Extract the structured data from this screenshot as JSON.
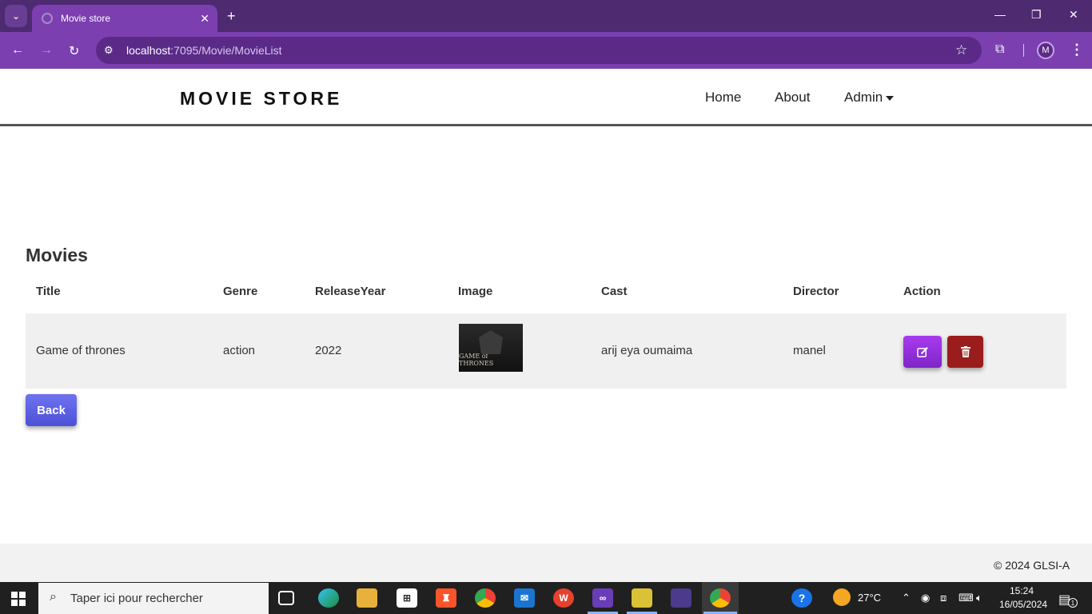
{
  "browser": {
    "tab_title": "Movie store",
    "tab_close": "✕",
    "new_tab": "+",
    "url_host": "localhost",
    "url_path": ":7095/Movie/MovieList",
    "profile_initial": "M",
    "window_controls": [
      "—",
      "❐",
      "✕"
    ]
  },
  "site": {
    "brand": "MOVIE STORE",
    "nav": [
      "Home",
      "About",
      "Admin"
    ]
  },
  "main": {
    "heading": "Movies",
    "columns": [
      "Title",
      "Genre",
      "ReleaseYear",
      "Image",
      "Cast",
      "Director",
      "Action"
    ],
    "rows": [
      {
        "title": "Game of thrones",
        "genre": "action",
        "release_year": "2022",
        "image_caption": "GAME of THRONES",
        "cast": "arij eya oumaima",
        "director": "manel"
      }
    ],
    "back_label": "Back",
    "colors": {
      "edit": "#8e2de2",
      "delete": "#9b1c1c",
      "back": "#5b5fe3"
    }
  },
  "footer": {
    "text": "© 2024 GLSI-A"
  },
  "taskbar": {
    "search_placeholder": "Taper ici pour rechercher",
    "weather": "27°C",
    "time": "15:24",
    "date": "16/05/2024",
    "notification_count": "1"
  }
}
